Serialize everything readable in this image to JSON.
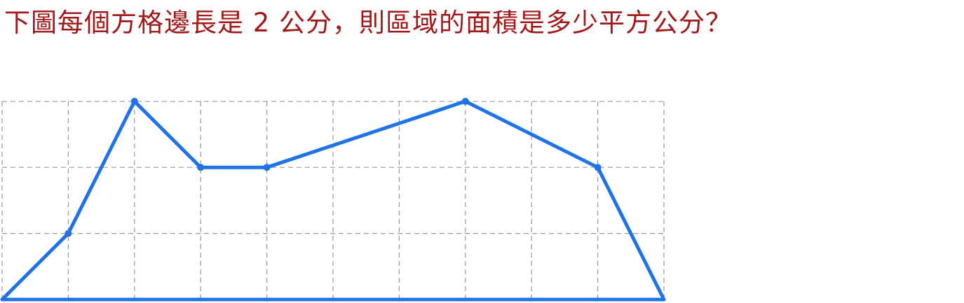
{
  "question": {
    "text": "下圖每個方格邊長是 2 公分，則區域的面積是多少平方公分？"
  },
  "figure": {
    "grid_columns": 10,
    "grid_rows": 3,
    "square_side_cm": 2,
    "polygon_vertices": [
      [
        0,
        0
      ],
      [
        1,
        1
      ],
      [
        2,
        3
      ],
      [
        3,
        2
      ],
      [
        4,
        2
      ],
      [
        7,
        3
      ],
      [
        9,
        2
      ],
      [
        10,
        0
      ]
    ],
    "colors": {
      "question_text": "#a01818",
      "grid": "#999999",
      "polygon": "#1f72e8"
    }
  }
}
